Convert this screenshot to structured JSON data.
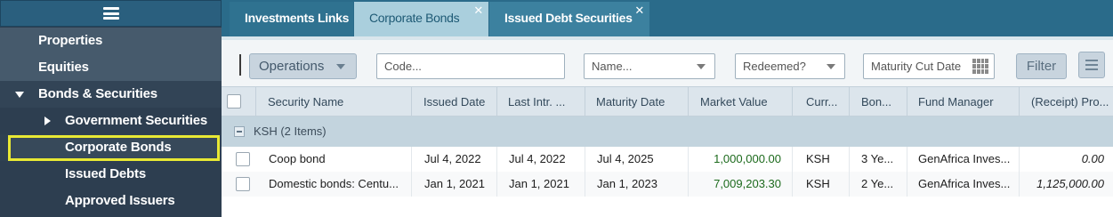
{
  "sidebar": {
    "menu_icon": "hamburger-icon",
    "items": [
      {
        "label": "Properties"
      },
      {
        "label": "Equities"
      },
      {
        "label": "Bonds & Securities"
      },
      {
        "label": "Government Securities"
      },
      {
        "label": "Corporate Bonds"
      },
      {
        "label": "Issued Debts"
      },
      {
        "label": "Approved Issuers"
      }
    ],
    "expanded_icon": "triangle-down-icon",
    "collapsed_icon": "triangle-right-icon",
    "highlight_color": "#e8e834"
  },
  "tabs": [
    {
      "label": "Investments Links"
    },
    {
      "label": "Corporate Bonds",
      "close": "✕"
    },
    {
      "label": "Issued Debt Securities",
      "close": "✕"
    }
  ],
  "toolbar": {
    "operations_label": "Operations",
    "code_placeholder": "Code...",
    "name_placeholder": "Name...",
    "redeemed_placeholder": "Redeemed?",
    "maturity_placeholder": "Maturity Cut Date",
    "filter_label": "Filter"
  },
  "grid": {
    "columns": [
      "Security Name",
      "Issued Date",
      "Last Intr. ...",
      "Maturity Date",
      "Market Value",
      "Curr...",
      "Bon...",
      "Fund Manager",
      "(Receipt) Pro..."
    ],
    "group_label": "KSH (2 Items)",
    "rows": [
      {
        "name": "Coop bond",
        "issued": "Jul 4, 2022",
        "last_intr": "Jul 4, 2022",
        "maturity": "Jul 4, 2025",
        "market_value": "1,000,000.00",
        "currency": "KSH",
        "bond": "3 Ye...",
        "fund_manager": "GenAfrica Inves...",
        "receipt": "0.00"
      },
      {
        "name": "Domestic bonds: Centu...",
        "issued": "Jan 1, 2021",
        "last_intr": "Jan 1, 2021",
        "maturity": "Jan 1, 2023",
        "market_value": "7,009,203.30",
        "currency": "KSH",
        "bond": "2 Ye...",
        "fund_manager": "GenAfrica Inves...",
        "receipt": "1,125,000.00"
      }
    ]
  },
  "colors": {
    "sidebar_bg": "#2d3e50",
    "tabbar_bg": "#2a6b8a",
    "active_tab_bg": "#aacfdd",
    "market_value_text": "#1c6a1c"
  }
}
